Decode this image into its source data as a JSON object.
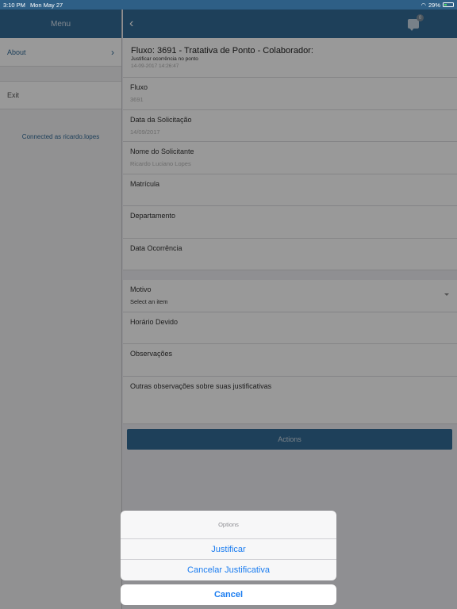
{
  "status": {
    "time": "3:10 PM",
    "date": "Mon May 27",
    "battery": "29%"
  },
  "sidebar": {
    "title": "Menu",
    "items": [
      {
        "label": "About"
      },
      {
        "label": "Exit"
      }
    ],
    "connected": "Connected as ricardo.lopes"
  },
  "nav": {
    "badge": "0"
  },
  "header": {
    "title": "Fluxo: 3691 - Tratativa de Ponto - Colaborador:",
    "subtitle": "Justificar ocorrência no ponto",
    "timestamp": "14-09-2017 14:26:47"
  },
  "fields": [
    {
      "label": "Fluxo",
      "value": "3691"
    },
    {
      "label": "Data da Solicitação",
      "value": "14/09/2017"
    },
    {
      "label": "Nome do Solicitante",
      "value": "Ricardo Luciano Lopes"
    },
    {
      "label": "Matrícula",
      "value": ""
    },
    {
      "label": "Departamento",
      "value": ""
    },
    {
      "label": "Data Ocorrência",
      "value": ""
    }
  ],
  "form": {
    "motivo_label": "Motivo",
    "motivo_value": "Select an item",
    "horario_label": "Horário Devido",
    "obs_label": "Observações",
    "outras_label": "Outras observações sobre suas justificativas"
  },
  "actions_label": "Actions",
  "sheet": {
    "title": "Options",
    "options": [
      "Justificar",
      "Cancelar Justificativa"
    ],
    "cancel": "Cancel"
  }
}
